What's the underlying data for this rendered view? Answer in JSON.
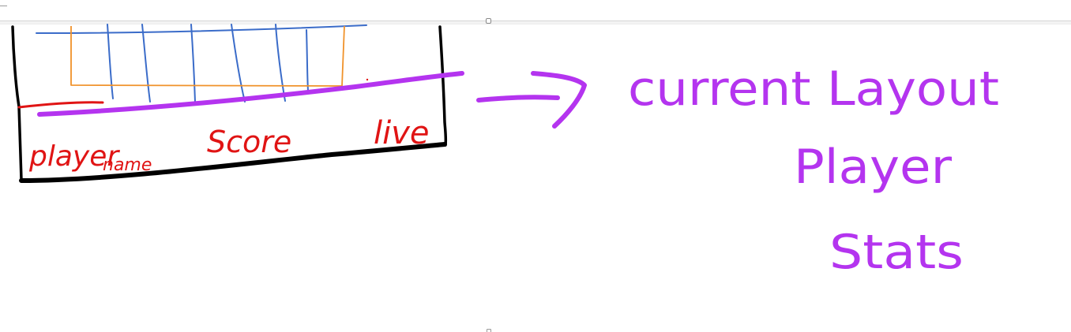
{
  "sketch": {
    "labels": {
      "player": "player",
      "name": "name",
      "score": "Score",
      "live": "live"
    },
    "notes": {
      "line1": "current Layout",
      "line2": "Player",
      "line3": "Stats"
    }
  },
  "colors": {
    "frame": "#000000",
    "grid": "#3b6cc9",
    "playfield": "#f0922a",
    "stats_labels": "#e01414",
    "annotation": "#b434ef",
    "ruler": "#d6d6d6"
  }
}
